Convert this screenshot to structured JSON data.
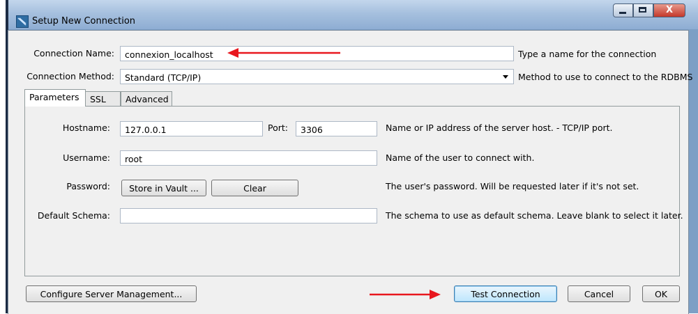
{
  "window": {
    "title": "Setup New Connection",
    "close_glyph": "X"
  },
  "form": {
    "connection_name_label": "Connection Name:",
    "connection_name_value": "connexion_localhost",
    "connection_name_hint": "Type a name for the connection",
    "connection_method_label": "Connection Method:",
    "connection_method_value": "Standard (TCP/IP)",
    "connection_method_hint": "Method to use to connect to the RDBMS"
  },
  "tabs": [
    {
      "label": "Parameters",
      "active": true
    },
    {
      "label": "SSL",
      "active": false
    },
    {
      "label": "Advanced",
      "active": false
    }
  ],
  "parameters": {
    "hostname_label": "Hostname:",
    "hostname_value": "127.0.0.1",
    "port_label": "Port:",
    "port_value": "3306",
    "hostname_hint": "Name or IP address of the server host. - TCP/IP port.",
    "username_label": "Username:",
    "username_value": "root",
    "username_hint": "Name of the user to connect with.",
    "password_label": "Password:",
    "store_vault_label": "Store in Vault ...",
    "clear_label": "Clear",
    "password_hint": "The user's password. Will be requested later if it's not set.",
    "schema_label": "Default Schema:",
    "schema_value": "",
    "schema_hint": "The schema to use as default schema. Leave blank to select it later."
  },
  "buttons": {
    "configure": "Configure Server Management...",
    "test": "Test Connection",
    "cancel": "Cancel",
    "ok": "OK"
  },
  "colors": {
    "annotation_arrow": "#e8171e",
    "titlebar": "#a6c0de"
  }
}
